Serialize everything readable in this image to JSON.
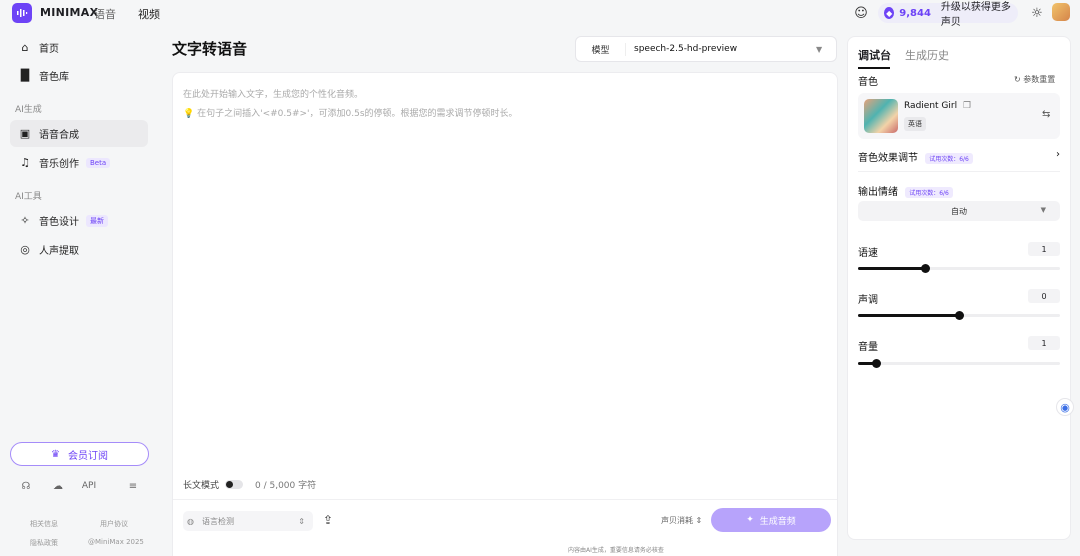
{
  "topbar": {
    "brand": "MINIMAX",
    "nav": [
      "语音",
      "视频"
    ],
    "credits": "9,844",
    "upgrade_text": "升级以获得更多声贝"
  },
  "sidebar": {
    "items": [
      {
        "label": "首页"
      },
      {
        "label": "音色库"
      },
      {
        "label": "语音合成"
      },
      {
        "label": "音乐创作",
        "badge": "Beta"
      },
      {
        "label": "音色设计",
        "badge": "最新"
      },
      {
        "label": "人声提取"
      }
    ],
    "groups": [
      "AI生成",
      "AI工具"
    ],
    "member_label": "会员订阅",
    "api_label": "API",
    "footer": [
      "相关信息",
      "用户协议",
      "隐私政策",
      "@MiniMax 2025"
    ]
  },
  "main": {
    "title": "文字转语音",
    "model_label": "模型",
    "model_value": "speech-2.5-hd-preview",
    "placeholder_line1": "在此处开始输入文字，生成您的个性化音频。",
    "placeholder_line2": "在句子之间插入'<#0.5#>'，可添加0.5s的停顿。根据您的需求调节停顿时长。",
    "long_mode_label": "长文模式",
    "char_count": "0 / 5,000 字符",
    "lang_detect": "语言检测",
    "cost_label": "声贝消耗",
    "generate_label": "生成音频",
    "bottom_notice": "内容由AI生成，重要信息请务必核查"
  },
  "right": {
    "tabs": [
      "调试台",
      "生成历史"
    ],
    "voice_section": "音色",
    "reset_label": "参数重置",
    "voice_name": "Radient Girl",
    "voice_lang": "英语",
    "effect_label": "音色效果调节",
    "trial_text": "试用次数：6/6",
    "emotion_label": "输出情绪",
    "emotion_value": "自动",
    "speed_label": "语速",
    "speed_value": "1",
    "pitch_label": "声调",
    "pitch_value": "0",
    "volume_label": "音量",
    "volume_value": "1",
    "speed_fraction": 0.33,
    "pitch_fraction": 0.5,
    "volume_fraction": 0.09
  },
  "colors": {
    "accent": "#6d43f6",
    "generate_disabled": "#b7a3fb"
  }
}
